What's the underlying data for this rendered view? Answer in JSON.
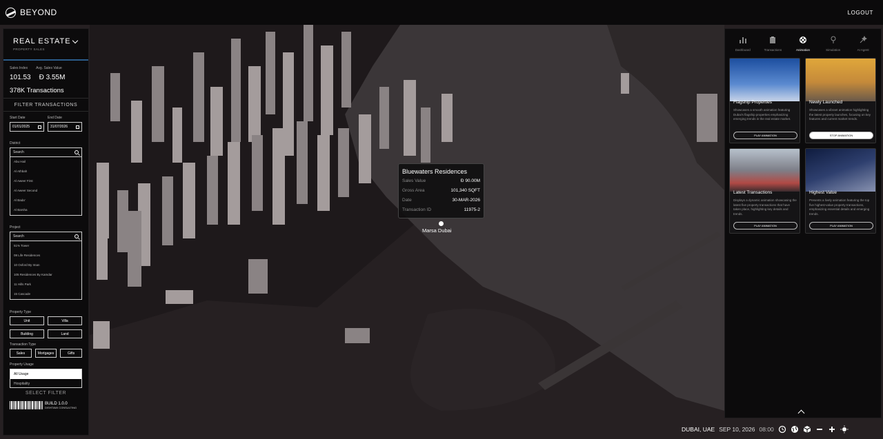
{
  "topbar": {
    "brand": "BEYOND",
    "logout": "LOGOUT"
  },
  "left": {
    "title": "REAL ESTATE",
    "subtitle": "PROPERTY SALES",
    "sales_index_label": "Sales Index",
    "avg_value_label": "Avg. Sales Value",
    "sales_index": "101.53",
    "avg_value": "3.55M",
    "transactions": "378K Transactions",
    "filter_title": "FILTER TRANSACTIONS",
    "start_label": "Start Date",
    "start_value": "01/01/2025",
    "end_label": "End Date",
    "end_value": "31/07/2026",
    "district_label": "District",
    "district_placeholder": "Search",
    "districts": [
      "Abu Hail",
      "Al Athbah",
      "Al Aweer First",
      "Al Aweer Second",
      "Al Bada'",
      "Al Barsha"
    ],
    "project_label": "Project",
    "project_placeholder": "Search",
    "projects": [
      "51% Tower",
      "08 Life Residences",
      "10 Oxford By Iman",
      "105 Residences By Kamdar",
      "11 Hills Park",
      "15 Cascade"
    ],
    "property_type_label": "Property Type",
    "property_types": [
      "Unit",
      "Villa",
      "Building",
      "Land"
    ],
    "transaction_type_label": "Transaction Type",
    "transaction_types": [
      "Sales",
      "Mortgages",
      "Gifts"
    ],
    "usage_label": "Property Usage",
    "usage_selected": "All Usage",
    "usage_next": "Hospitality",
    "select_filter": "SELECT FILTER",
    "build": "BUILD 1.0.0",
    "build_sub": "DISHTAWI CONSULTING"
  },
  "tooltip": {
    "title": "Bluewaters Residences",
    "rows": [
      {
        "k": "Sales Value",
        "v": "90.00M"
      },
      {
        "k": "Gross Area",
        "v": "101,340 SQFT"
      },
      {
        "k": "Date",
        "v": "30-MAR-2026"
      },
      {
        "k": "Transaction ID",
        "v": "11975-2"
      }
    ]
  },
  "pin_label": "Marsa Dubai",
  "right": {
    "tabs": [
      "Dashboard",
      "Transactions",
      "Animation",
      "Simulation",
      "AI Agent"
    ],
    "active_tab": "Animation",
    "cards": [
      {
        "title": "Flagship Properties",
        "desc": "Showcases a smooth animation featuring Dubai's flagship properties emphasizing emerging trends in the real estate market.",
        "button": "PLAY ANIMATION",
        "active": false
      },
      {
        "title": "Newly Launched",
        "desc": "Showcases a vibrant animation highlighting the latest property launches, focusing on key features and current market trends.",
        "button": "STOP ANIMATION",
        "active": true
      },
      {
        "title": "Latest Transactions",
        "desc": "Displays a dynamic animation showcasing the latest five property transactions that have taken place, highlighting key details and trends.",
        "button": "PLAY ANIMATION",
        "active": false
      },
      {
        "title": "Highest Value",
        "desc": "Presents a lively animation featuring the top five highest-value property transactions, emphasizing essential details and emerging trends.",
        "button": "PLAY ANIMATION",
        "active": false
      }
    ]
  },
  "bottom": {
    "location": "DUBAI, UAE",
    "date": "SEP 10, 2026",
    "time": "08:00"
  },
  "colors": {
    "accent": "#2a5c8a",
    "panel": "#0c0b0c",
    "map_bg": "#231d1f"
  }
}
